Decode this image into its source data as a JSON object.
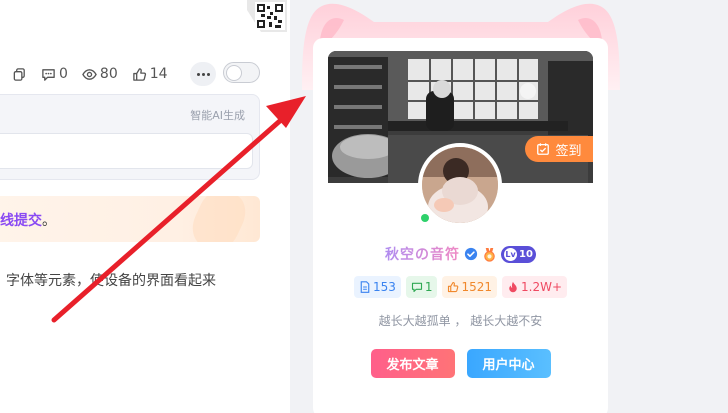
{
  "post_stats": {
    "comments": "0",
    "views": "80",
    "likes": "14"
  },
  "ai_panel": {
    "tag": "智能AI生成"
  },
  "notice": {
    "text": "线提交",
    "tail": "。"
  },
  "article": {
    "text_fragment": "字体等元素，使设备的界面看起来"
  },
  "profile": {
    "checkin_label": "签到",
    "username": "秋空の音符",
    "level": "10",
    "stats": {
      "posts": "153",
      "comments": "1",
      "likes": "1521",
      "popularity": "1.2W+"
    },
    "motto": "越长大越孤单 ， 越长大越不安",
    "publish_button": "发布文章",
    "user_center_button": "用户中心"
  },
  "colors": {
    "accent_purple": "#8a4af3",
    "checkin_orange": "#ff8a3d",
    "button_pink": "#ff5f8a",
    "button_blue": "#3aa7ff",
    "arrow_red": "#e8202a"
  },
  "icons": [
    "qr-code-icon",
    "copy-icon",
    "comment-icon",
    "eye-icon",
    "thumbs-up-icon",
    "more-icon",
    "verified-icon",
    "medal-icon",
    "document-icon",
    "fire-icon",
    "calendar-check-icon"
  ]
}
